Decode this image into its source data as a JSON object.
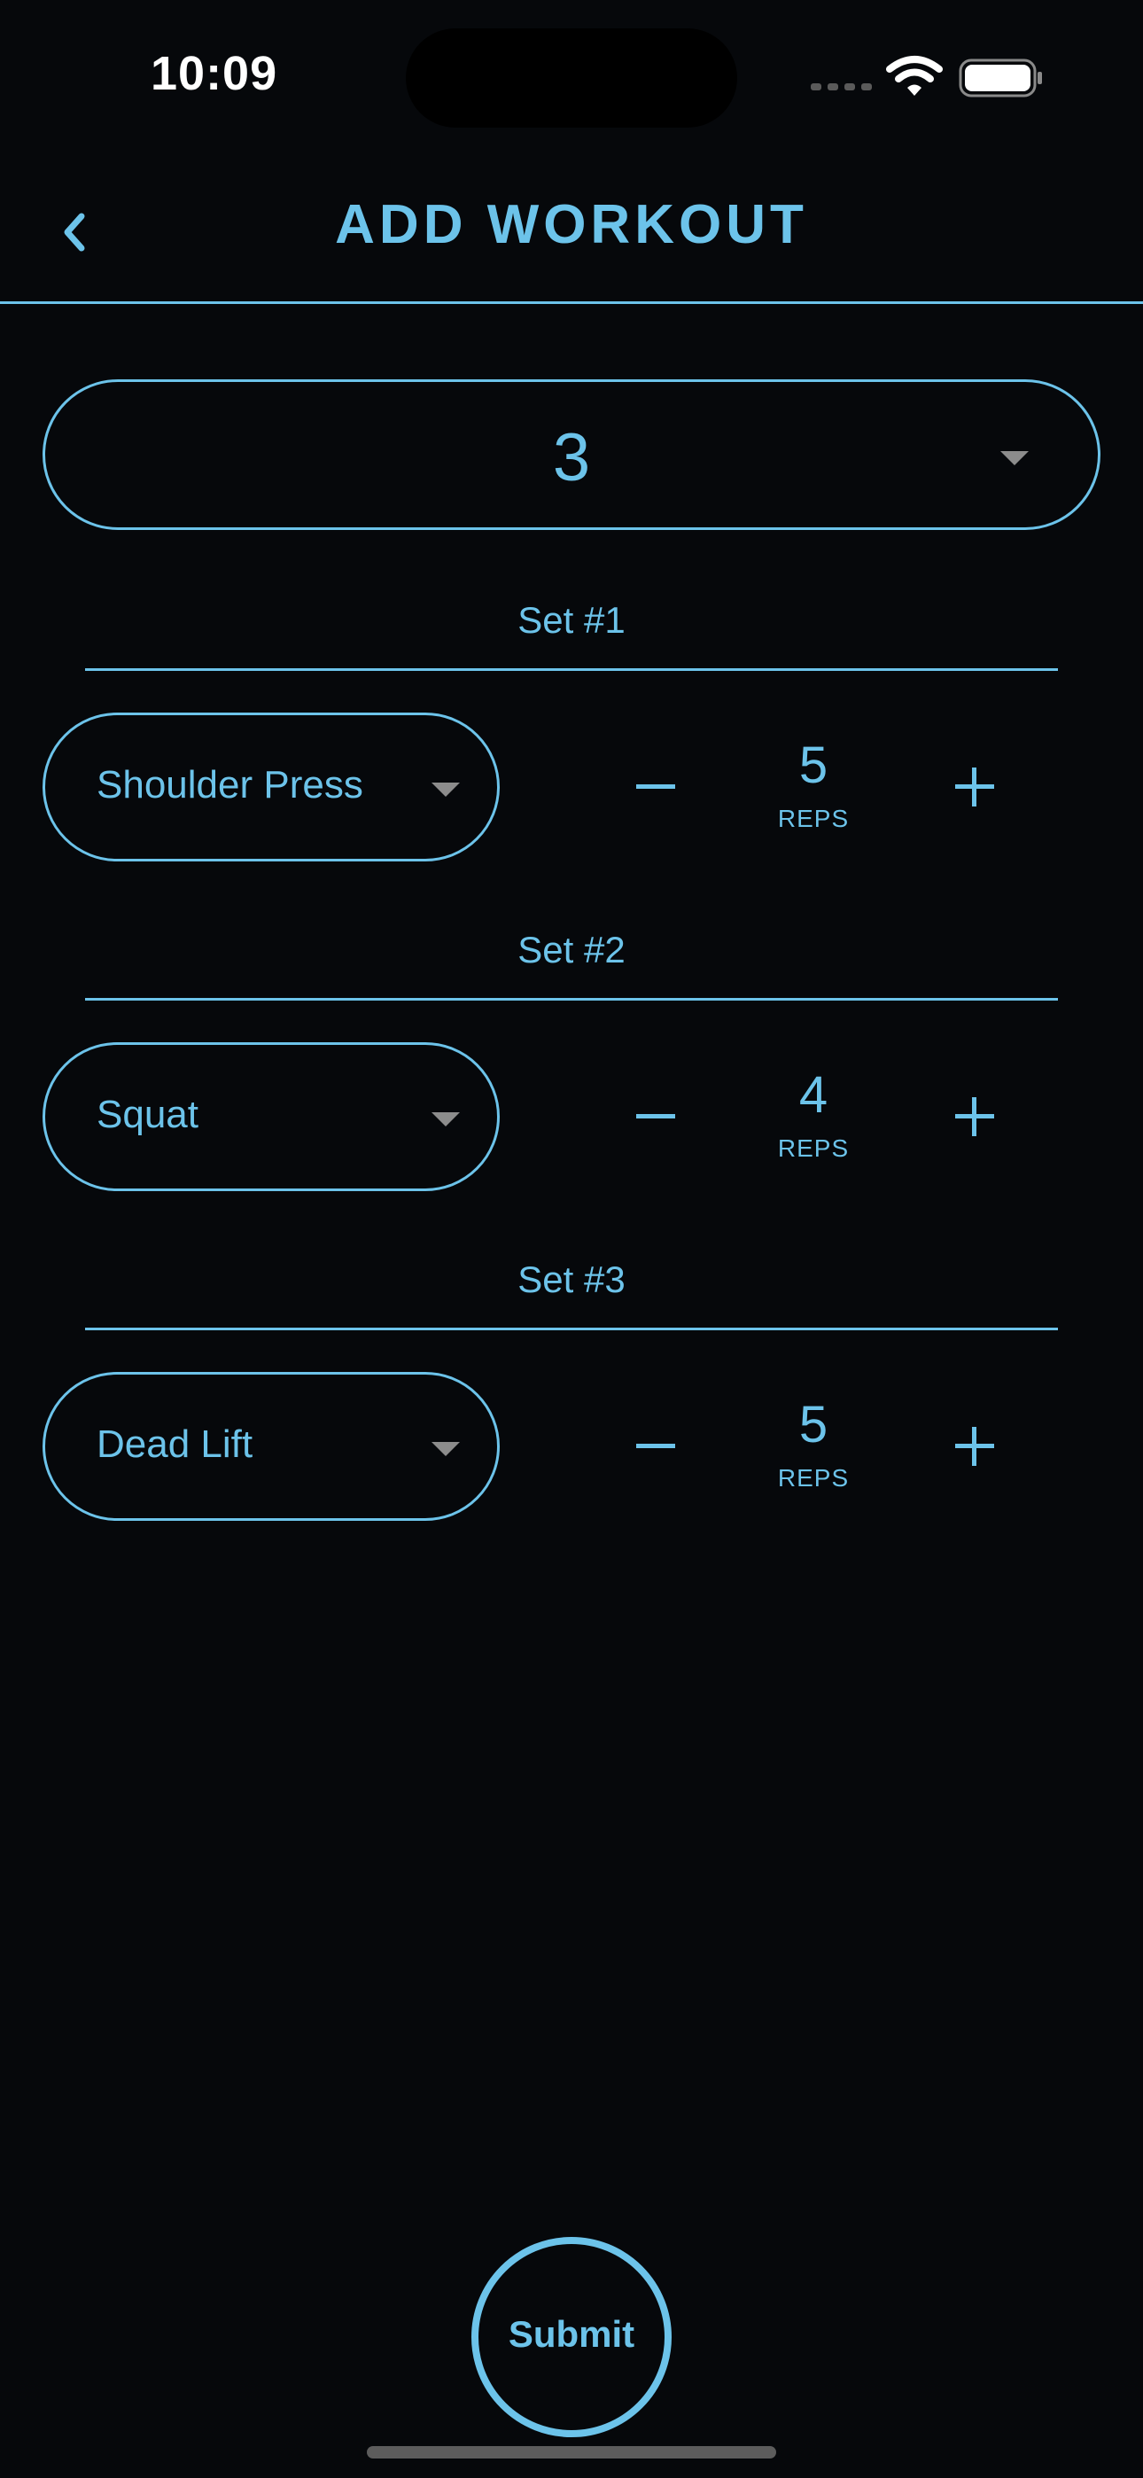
{
  "status_bar": {
    "time": "10:09"
  },
  "header": {
    "title": "ADD WORKOUT",
    "back_icon": "chevron-left-icon"
  },
  "sets_count": {
    "value": "3",
    "icon": "dropdown-triangle-icon"
  },
  "sets": [
    {
      "label": "Set #1",
      "exercise": "Shoulder Press",
      "reps": "5",
      "reps_unit": "REPS"
    },
    {
      "label": "Set #2",
      "exercise": "Squat",
      "reps": "4",
      "reps_unit": "REPS"
    },
    {
      "label": "Set #3",
      "exercise": "Dead Lift",
      "reps": "5",
      "reps_unit": "REPS"
    }
  ],
  "submit": {
    "label": "Submit"
  },
  "colors": {
    "accent": "#6cc3ea",
    "background": "#06080b",
    "dropdown_arrow": "#8c8c8c"
  }
}
